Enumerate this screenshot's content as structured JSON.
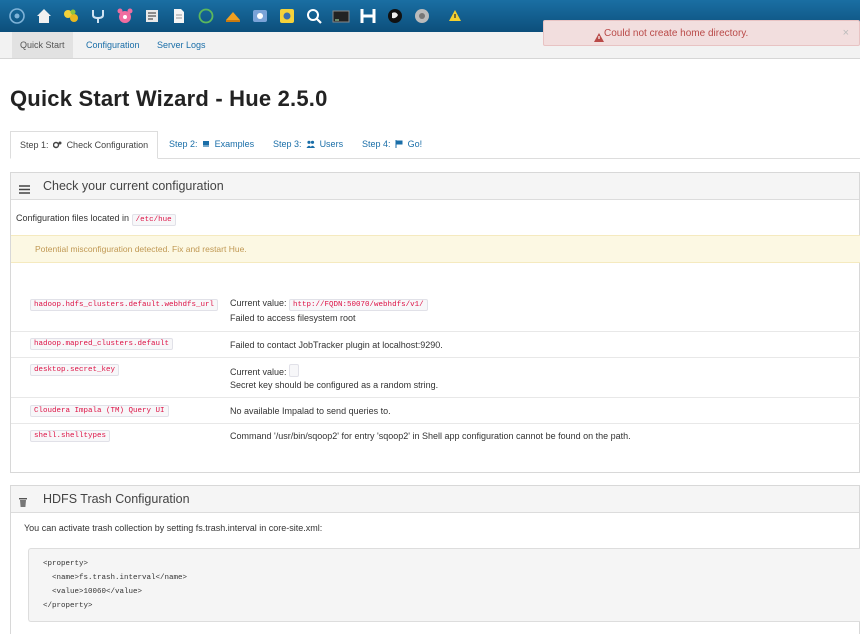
{
  "topbar": {
    "icons": [
      "hue-logo-icon",
      "home-icon",
      "query-editors-icon",
      "data-browsers-icon",
      "workflows-icon",
      "search-icon",
      "file-browser-icon",
      "job-browser-icon",
      "pig-icon",
      "metastore-icon",
      "impala-icon",
      "find-icon",
      "shell-icon",
      "hbase-icon",
      "sqoop-icon",
      "help-icon",
      "warning-icon"
    ]
  },
  "subnav": {
    "quick_start": "Quick Start",
    "configuration": "Configuration",
    "server_logs": "Server Logs"
  },
  "alert": {
    "message": "Could not create home directory.",
    "close": "×"
  },
  "page": {
    "title": "Quick Start Wizard - Hue 2.5.0"
  },
  "tabs": [
    {
      "prefix": "Step 1:",
      "label": "Check Configuration"
    },
    {
      "prefix": "Step 2:",
      "label": "Examples"
    },
    {
      "prefix": "Step 3:",
      "label": "Users"
    },
    {
      "prefix": "Step 4:",
      "label": "Go!"
    }
  ],
  "config_panel": {
    "title": "Check your current configuration",
    "files_text": "Configuration files located in",
    "files_path": "/etc/hue",
    "warning": "Potential misconfiguration detected. Fix and restart Hue.",
    "rows": [
      {
        "key": "hadoop.hdfs_clusters.default.webhdfs_url",
        "current_label": "Current value:",
        "current_value": "http://FQDN:50070/webhdfs/v1/",
        "message": "Failed to access filesystem root"
      },
      {
        "key": "hadoop.mapred_clusters.default",
        "message": "Failed to contact JobTracker plugin at localhost:9290."
      },
      {
        "key": "desktop.secret_key",
        "current_label": "Current value:",
        "current_value": "",
        "message": "Secret key should be configured as a random string."
      },
      {
        "key": "Cloudera Impala (TM) Query UI",
        "message": "No available Impalad to send queries to."
      },
      {
        "key": "shell.shelltypes",
        "message": "Command '/usr/bin/sqoop2' for entry 'sqoop2' in Shell app configuration cannot be found on the path."
      }
    ]
  },
  "trash_panel": {
    "title": "HDFS Trash Configuration",
    "text": "You can activate trash collection by setting fs.trash.interval in core-site.xml:",
    "code": [
      "<property>",
      "  <name>fs.trash.interval</name>",
      "  <value>10060</value>",
      "</property>"
    ]
  }
}
